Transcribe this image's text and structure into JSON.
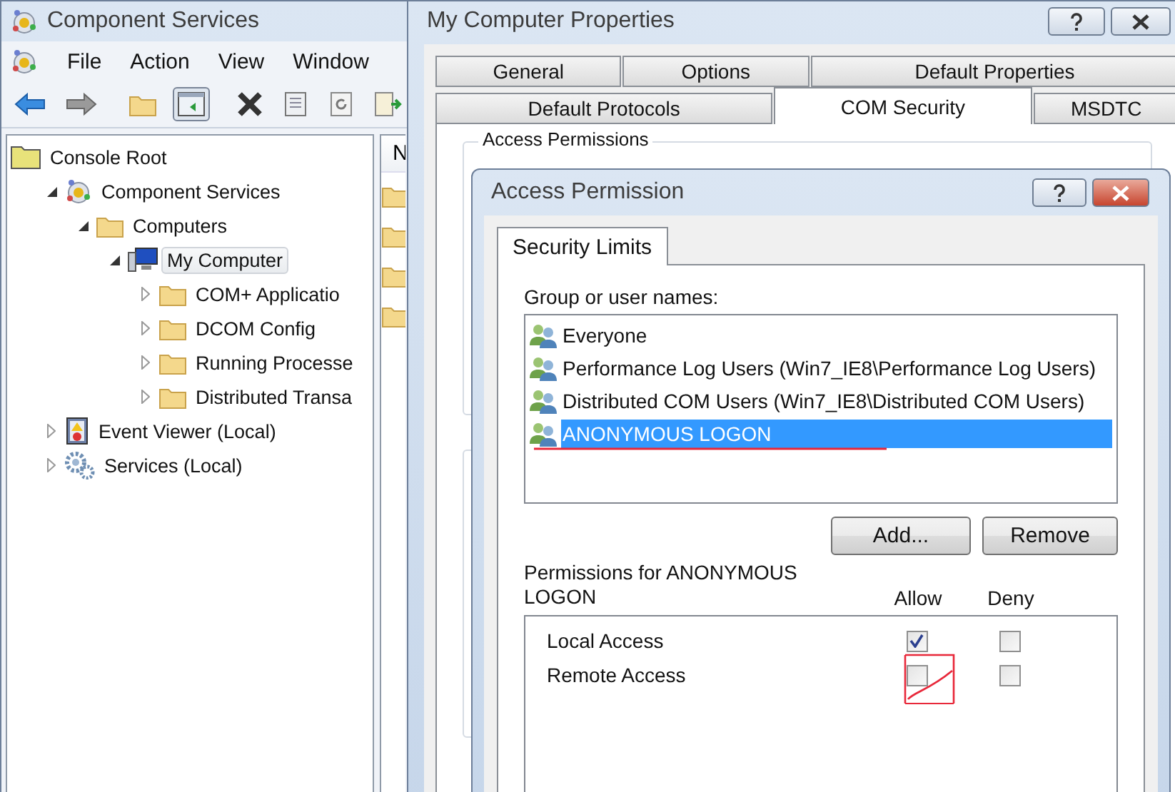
{
  "main_window": {
    "title": "Component Services",
    "menu": [
      "File",
      "Action",
      "View",
      "Window"
    ],
    "tree": [
      {
        "label": "Console Root",
        "kind": "root",
        "selected": false,
        "children": [
          {
            "label": "Component Services",
            "kind": "app",
            "expanded": true,
            "selected": false,
            "children": [
              {
                "label": "Computers",
                "kind": "folder",
                "expanded": true,
                "selected": false,
                "children": [
                  {
                    "label": "My Computer",
                    "kind": "computer",
                    "expanded": true,
                    "selected": true,
                    "children": [
                      {
                        "label": "COM+ Applicatio",
                        "kind": "folder",
                        "expanded": false,
                        "selected": false
                      },
                      {
                        "label": "DCOM Config",
                        "kind": "folder",
                        "expanded": false,
                        "selected": false
                      },
                      {
                        "label": "Running Processe",
                        "kind": "folder",
                        "expanded": false,
                        "selected": false
                      },
                      {
                        "label": "Distributed Transa",
                        "kind": "folder",
                        "expanded": false,
                        "selected": false
                      }
                    ]
                  }
                ]
              }
            ]
          },
          {
            "label": "Event Viewer (Local)",
            "kind": "log",
            "expanded": false,
            "selected": false
          },
          {
            "label": "Services (Local)",
            "kind": "gears",
            "expanded": false,
            "selected": false
          }
        ]
      }
    ],
    "list_header": "N"
  },
  "properties_window": {
    "title": "My Computer Properties",
    "tab_rows": [
      [
        {
          "label": "General",
          "selected": false
        },
        {
          "label": "Options",
          "selected": false
        },
        {
          "label": "Default Properties",
          "selected": false
        }
      ],
      [
        {
          "label": "Default Protocols",
          "selected": false
        },
        {
          "label": "COM Security",
          "selected": true
        },
        {
          "label": "MSDTC",
          "selected": false
        }
      ]
    ],
    "group_label": "Access Permissions"
  },
  "dialog": {
    "title": "Access Permission",
    "tabs": [
      {
        "label": "Security Limits",
        "selected": true
      }
    ],
    "names_label": "Group or user names:",
    "names": [
      {
        "label": "Everyone",
        "selected": false
      },
      {
        "label": "Performance Log Users (Win7_IE8\\Performance Log Users)",
        "selected": false
      },
      {
        "label": "Distributed COM Users (Win7_IE8\\Distributed COM Users)",
        "selected": false
      },
      {
        "label": "ANONYMOUS LOGON",
        "selected": true
      }
    ],
    "buttons": [
      "Add...",
      "Remove"
    ],
    "permissions_label": "Permissions for ANONYMOUS LOGON",
    "columns": [
      "Allow",
      "Deny"
    ],
    "permissions": [
      {
        "label": "Local Access",
        "allow": true,
        "deny": false
      },
      {
        "label": "Remote Access",
        "allow": false,
        "deny": false
      }
    ]
  }
}
